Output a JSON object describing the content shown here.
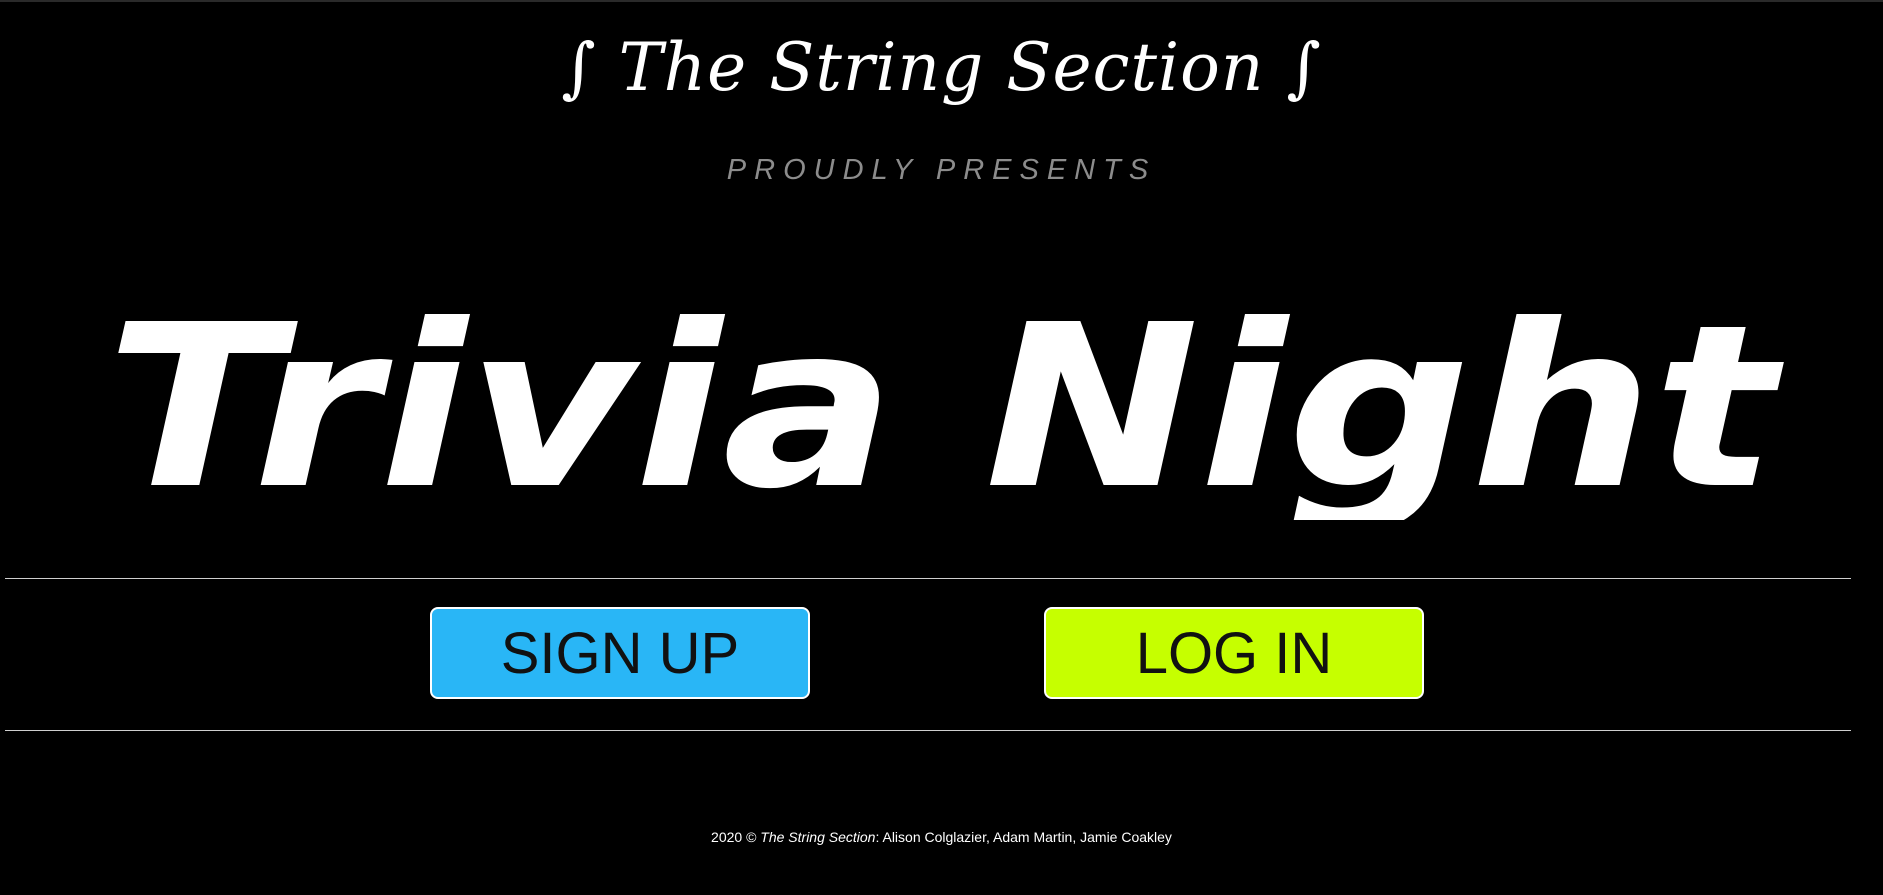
{
  "brand": {
    "title": "∫ The String Section ∫"
  },
  "subtitle": "PROUDLY PRESENTS",
  "hero": {
    "title": "Trivia Night"
  },
  "buttons": {
    "signup": "SIGN UP",
    "login": "LOG IN"
  },
  "footer": {
    "year": "2020 © ",
    "org": "The String Section",
    "credits": ": Alison Colglazier, Adam Martin, Jamie Coakley"
  },
  "colors": {
    "background": "#000000",
    "signup_button": "#29b6f6",
    "login_button": "#c6ff00",
    "divider": "#cfcfcf",
    "subtitle_text": "#8c8c8c"
  }
}
